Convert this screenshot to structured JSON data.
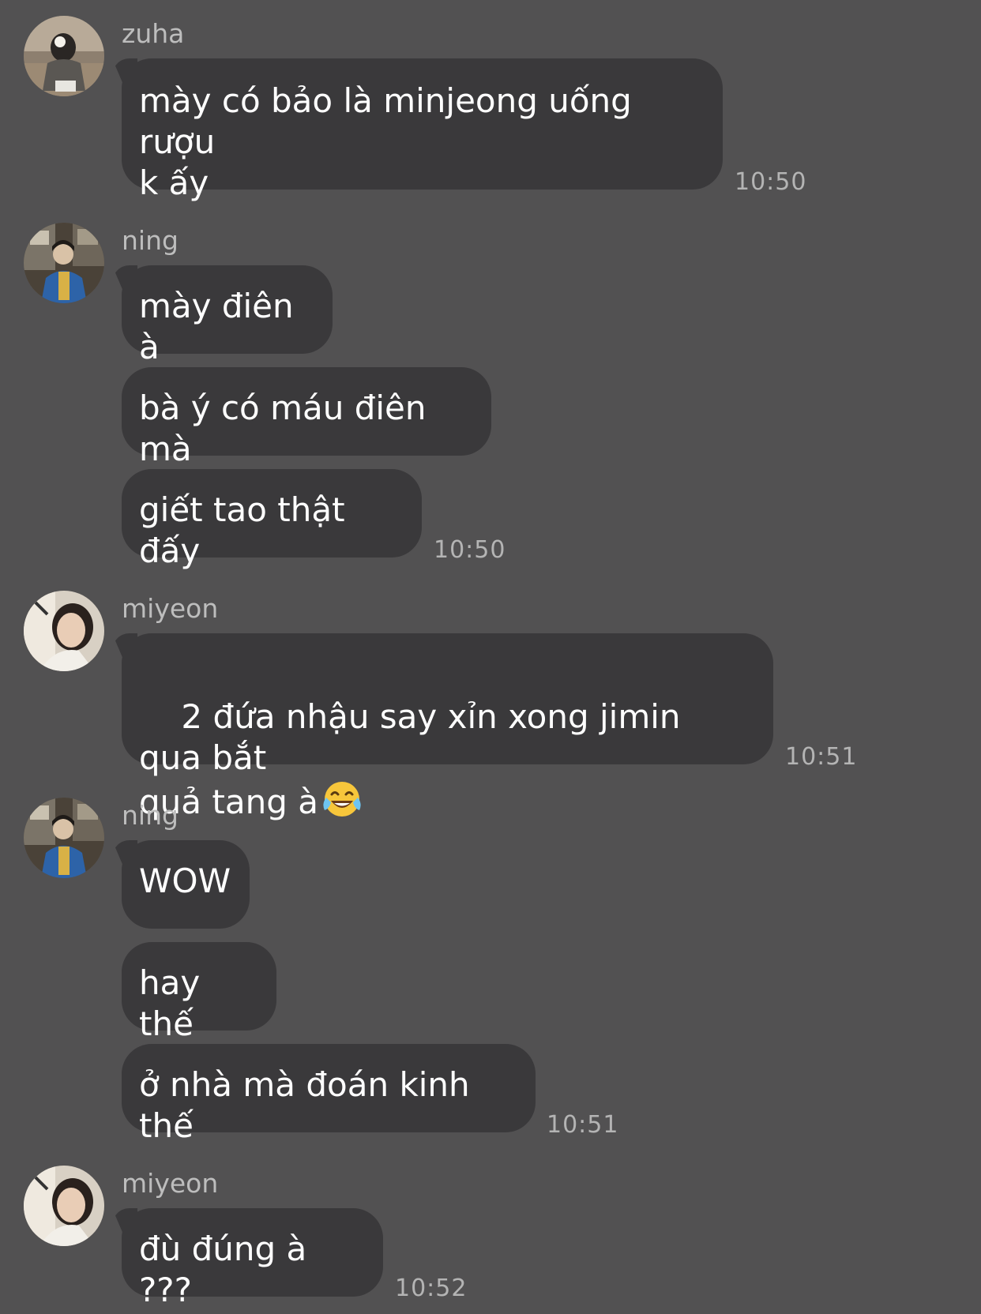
{
  "messages": [
    {
      "sender": "zuha",
      "avatar_icon": "zuha-avatar-photo",
      "bubbles": [
        "mày có bảo là minjeong uống rượu\nk ấy"
      ],
      "time": "10:50"
    },
    {
      "sender": "ning",
      "avatar_icon": "ning-avatar-photo",
      "bubbles": [
        "mày điên à",
        "bà ý có máu điên mà",
        "giết tao thật đấy"
      ],
      "time": "10:50"
    },
    {
      "sender": "miyeon",
      "avatar_icon": "miyeon-avatar-photo",
      "bubbles": [
        "2 đứa nhậu say xỉn xong jimin qua bắt\nquả tang à"
      ],
      "emoji": "face-with-tears-of-joy",
      "time": "10:51"
    },
    {
      "sender": "ning",
      "avatar_icon": "ning-avatar-photo",
      "bubbles": [
        "WOW",
        "hay thế",
        "ở nhà mà đoán kinh thế"
      ],
      "time": "10:51"
    },
    {
      "sender": "miyeon",
      "avatar_icon": "miyeon-avatar-photo",
      "bubbles": [
        "đù đúng à ???"
      ],
      "time": "10:52"
    }
  ],
  "colors": {
    "background": "#525152",
    "bubble": "#3a393b",
    "text": "#ffffff",
    "meta_text": "#bdbdbd"
  }
}
